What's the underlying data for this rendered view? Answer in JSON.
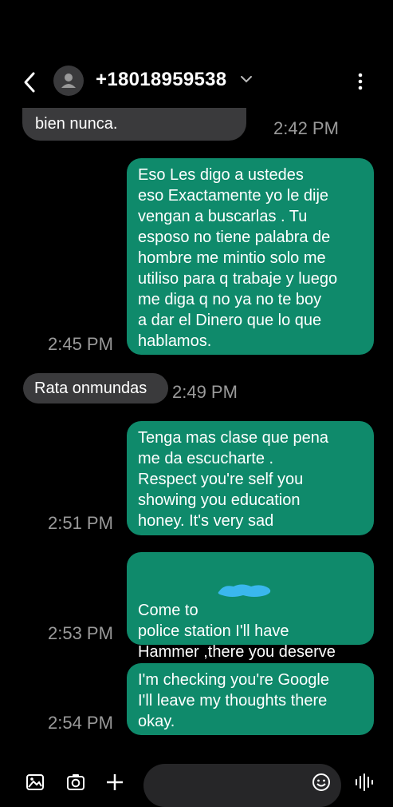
{
  "header": {
    "contact": "+18018959538",
    "icons": {
      "back": "chevron-left-icon",
      "avatar": "person-icon",
      "expand": "chevron-down-icon",
      "more": "more-vertical-icon"
    }
  },
  "messages": [
    {
      "direction": "incoming",
      "text": "bien nunca.",
      "time": "2:42 PM"
    },
    {
      "direction": "outgoing",
      "text": "Eso Les digo a ustedes\neso Exactamente yo le dije\nvengan a buscarlas . Tu\nesposo no tiene palabra de\nhombre me mintio solo me\nutiliso para q trabaje y luego\nme diga q no ya no te boy\na dar el Dinero que  lo que\nhablamos.",
      "time": "2:45 PM"
    },
    {
      "direction": "incoming",
      "text": "Rata onmundas",
      "time": "2:49 PM"
    },
    {
      "direction": "outgoing",
      "text": "Tenga mas clase que pena\nme da escucharte .\nRespect you're self you\nshowing you education\nhoney. It's very sad",
      "time": "2:51 PM"
    },
    {
      "direction": "outgoing",
      "text_line1": "Come to",
      "text_rest": "police station I'll have\nHammer ,there you deserve\nthat for lying to my husband.",
      "time": "2:53 PM"
    },
    {
      "direction": "outgoing",
      "text": "I'm checking you're Google\nI'll leave my thoughts there\nokay.",
      "time": "2:54 PM"
    }
  ],
  "composer": {
    "icons": [
      "gallery-icon",
      "camera-icon",
      "plus-icon",
      "emoji-icon",
      "voice-icon"
    ]
  },
  "colors": {
    "background": "#000000",
    "incoming_bubble": "#3a3a3c",
    "outgoing_bubble": "#0f8a6b",
    "redaction": "#3ab7ee"
  }
}
